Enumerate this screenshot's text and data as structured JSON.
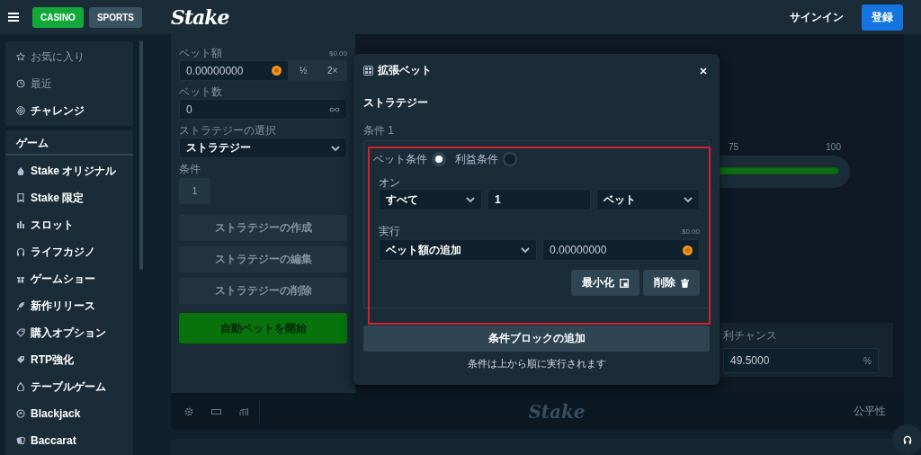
{
  "header": {
    "tabs": [
      {
        "label": "CASINO",
        "selected": true
      },
      {
        "label": "SPORTS",
        "selected": false
      }
    ],
    "logo": "Stake",
    "sign_in": "サインイン",
    "register": "登録"
  },
  "sidebar": {
    "top_items": [
      {
        "label": "お気に入り",
        "disabled": true
      },
      {
        "label": "最近",
        "disabled": true
      },
      {
        "label": "チャレンジ",
        "disabled": false
      }
    ],
    "section_title": "ゲーム",
    "items": [
      {
        "label": "Stake オリジナル",
        "disabled": false
      },
      {
        "label": "Stake 限定",
        "disabled": false
      },
      {
        "label": "スロット",
        "disabled": false
      },
      {
        "label": "ライフカジノ",
        "disabled": false
      },
      {
        "label": "ゲームショー",
        "disabled": false
      },
      {
        "label": "新作リリース",
        "disabled": false
      },
      {
        "label": "購入オプション",
        "disabled": false
      },
      {
        "label": "RTP強化",
        "disabled": false
      },
      {
        "label": "テーブルゲーム",
        "disabled": false
      },
      {
        "label": "Blackjack",
        "disabled": false
      },
      {
        "label": "Baccarat",
        "disabled": false
      }
    ]
  },
  "bet_panel": {
    "bet_amount": {
      "label": "ベット額",
      "usd": "$0.00",
      "value": "0.00000000",
      "half": "½",
      "double": "2×"
    },
    "bet_count": {
      "label": "ベット数",
      "value": "0"
    },
    "strategy": {
      "label": "ストラテジーの選択",
      "value": "ストラテジー"
    },
    "condition": {
      "label": "条件",
      "value": "1"
    },
    "buttons": [
      "ストラテジーの作成",
      "ストラテジーの編集",
      "ストラテジーの削除"
    ],
    "start_button": "自動ベットを開始"
  },
  "game": {
    "slider_ticks": [
      "75",
      "100"
    ],
    "win_chance": {
      "label": "利チャンス",
      "value": "49.5000",
      "suffix": "%"
    }
  },
  "footer": {
    "logo": "Stake",
    "fairness": "公平性"
  },
  "modal": {
    "title": "拡張ベット",
    "section": "ストラテジー",
    "condition_label": "条件 1",
    "condition_types": [
      {
        "label": "ベット条件",
        "selected": true
      },
      {
        "label": "利益条件",
        "selected": false
      }
    ],
    "on": {
      "label": "オン",
      "scope": "すべて",
      "count": "1",
      "unit": "ベット"
    },
    "action": {
      "label": "実行",
      "usd": "$0.00",
      "type": "ベット額の追加",
      "amount": "0.00000000"
    },
    "buttons": [
      {
        "label": "最小化",
        "kind": "minimize"
      },
      {
        "label": "削除",
        "kind": "delete"
      }
    ],
    "add_block": "条件ブロックの追加",
    "note": "条件は上から順に実行されます"
  }
}
